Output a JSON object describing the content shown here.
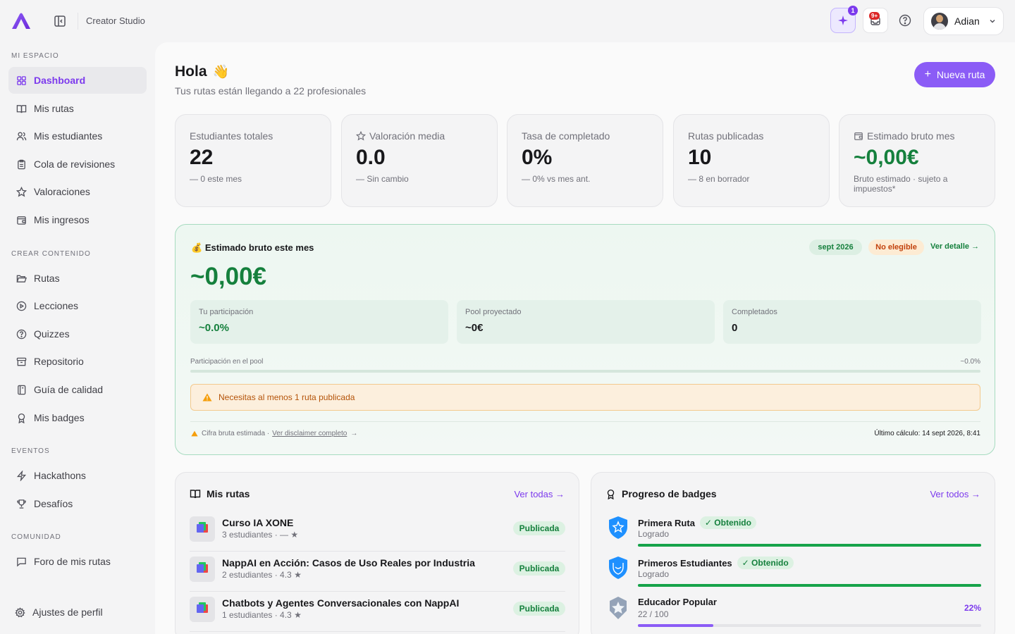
{
  "topbar": {
    "brand": "Creator Studio",
    "ai_badge": "1",
    "notif_badge": "9+",
    "user_name": "Adian"
  },
  "sidebar": {
    "sections": {
      "mi_espacio": "MI ESPACIO",
      "crear": "CREAR CONTENIDO",
      "eventos": "EVENTOS",
      "comunidad": "COMUNIDAD"
    },
    "items": {
      "dashboard": "Dashboard",
      "rutas_mis": "Mis rutas",
      "estudiantes": "Mis estudiantes",
      "revisiones": "Cola de revisiones",
      "valoraciones": "Valoraciones",
      "ingresos": "Mis ingresos",
      "rutas": "Rutas",
      "lecciones": "Lecciones",
      "quizzes": "Quizzes",
      "repositorio": "Repositorio",
      "calidad": "Guía de calidad",
      "badges": "Mis badges",
      "hackathons": "Hackathons",
      "desafios": "Desafíos",
      "foro": "Foro de mis rutas",
      "ajustes": "Ajustes de perfil"
    }
  },
  "header": {
    "greeting": "Hola",
    "wave": "👋",
    "subtitle": "Tus rutas están llegando a 22 profesionales",
    "new_button": "Nueva ruta"
  },
  "stats": [
    {
      "label": "Estudiantes totales",
      "value": "22",
      "sub": "— 0 este mes"
    },
    {
      "label": "Valoración media",
      "value": "0.0",
      "sub": "— Sin cambio"
    },
    {
      "label": "Tasa de completado",
      "value": "0%",
      "sub": "— 0% vs mes ant."
    },
    {
      "label": "Rutas publicadas",
      "value": "10",
      "sub": "— 8 en borrador"
    },
    {
      "label": "Estimado bruto mes",
      "value": "~0,00€",
      "sub": "Bruto estimado · sujeto a impuestos*"
    }
  ],
  "earnings": {
    "icon": "💰",
    "title": "Estimado bruto este mes",
    "date_pill": "sept 2026",
    "status_pill": "No elegible",
    "detail_link": "Ver detalle →",
    "amount": "~0,00€",
    "metrics": [
      {
        "label": "Tu participación",
        "value": "~0.0%"
      },
      {
        "label": "Pool proyectado",
        "value": "~0€"
      },
      {
        "label": "Completados",
        "value": "0"
      }
    ],
    "pool_label": "Participación en el pool",
    "pool_pct": "~0.0%",
    "pool_fraction": 0,
    "warning": "Necesitas al menos 1 ruta publicada",
    "disclaimer": "Cifra bruta estimada ·",
    "disclaimer_link": "Ver disclaimer completo",
    "last_calc": "Último cálculo: 14 sept 2026, 8:41"
  },
  "routes": {
    "title": "Mis rutas",
    "link": "Ver todas →",
    "items": [
      {
        "title": "Curso IA XONE",
        "sub": "3 estudiantes · — ★",
        "status": "Publicada"
      },
      {
        "title": "NappAI en Acción: Casos de Uso Reales por Industria",
        "sub": "2 estudiantes · 4.3 ★",
        "status": "Publicada"
      },
      {
        "title": "Chatbots y Agentes Conversacionales con NappAI",
        "sub": "1 estudiantes · 4.3 ★",
        "status": "Publicada"
      }
    ]
  },
  "badges": {
    "title": "Progreso de badges",
    "link": "Ver todos →",
    "items": [
      {
        "name": "Primera Ruta",
        "tag": "✓ Obtenido",
        "sub": "Logrado",
        "progress": 1.0
      },
      {
        "name": "Primeros Estudiantes",
        "tag": "✓ Obtenido",
        "sub": "Logrado",
        "progress": 1.0
      },
      {
        "name": "Educador Popular",
        "sub": "22 / 100",
        "pct": "22%",
        "progress": 0.22
      }
    ]
  },
  "colors": {
    "accent": "#8b5cf6",
    "success": "#15803d",
    "warning": "#b45309"
  }
}
